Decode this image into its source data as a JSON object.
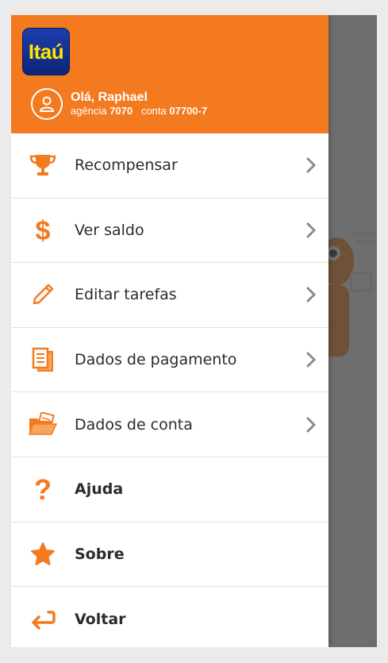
{
  "header": {
    "logo_text": "Itaú",
    "greeting": "Olá, Raphael",
    "agency_label": "agência",
    "agency_number": "7070",
    "account_label": "conta",
    "account_number": "07700-7",
    "color": "#f47a20"
  },
  "menu": {
    "items": [
      {
        "label": "Recompensar",
        "icon": "trophy-icon",
        "chevron": true
      },
      {
        "label": "Ver saldo",
        "icon": "dollar-icon",
        "chevron": true
      },
      {
        "label": "Editar tarefas",
        "icon": "pencil-icon",
        "chevron": true
      },
      {
        "label": "Dados de pagamento",
        "icon": "documents-icon",
        "chevron": true
      },
      {
        "label": "Dados de conta",
        "icon": "folder-icon",
        "chevron": true
      },
      {
        "label": "Ajuda",
        "icon": "question-icon",
        "chevron": false
      },
      {
        "label": "Sobre",
        "icon": "star-icon",
        "chevron": false
      },
      {
        "label": "Voltar",
        "icon": "back-arrow-icon",
        "chevron": false
      }
    ]
  },
  "colors": {
    "accent": "#f47a20",
    "chevron": "#8c8c8c",
    "overlay": "#3c3c3c"
  }
}
